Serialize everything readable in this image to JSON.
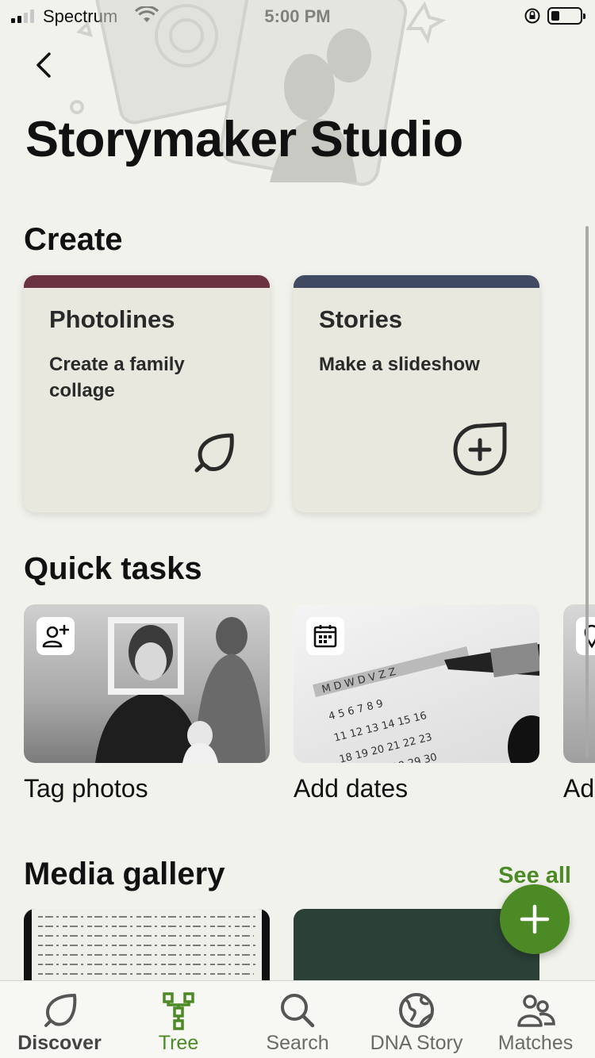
{
  "status_bar": {
    "carrier": "Spectrum",
    "time": "5:00 PM",
    "battery_level": 0.3
  },
  "header": {
    "title": "Storymaker Studio"
  },
  "create": {
    "heading": "Create",
    "cards": [
      {
        "title": "Photolines",
        "subtitle": "Create a family collage",
        "accent": "#6b3341",
        "icon": "leaf-icon"
      },
      {
        "title": "Stories",
        "subtitle": "Make a slideshow",
        "accent": "#414a63",
        "icon": "add-story-icon"
      }
    ]
  },
  "quick_tasks": {
    "heading": "Quick tasks",
    "items": [
      {
        "label": "Tag photos",
        "icon": "tag-person-icon"
      },
      {
        "label": "Add dates",
        "icon": "calendar-icon"
      },
      {
        "label": "Ad",
        "icon": "location-pin-icon"
      }
    ]
  },
  "media_gallery": {
    "heading": "Media gallery",
    "see_all": "See all"
  },
  "fab": {
    "icon": "plus-icon"
  },
  "tab_bar": {
    "tabs": [
      {
        "label": "Discover",
        "icon": "leaf-icon",
        "state": "current"
      },
      {
        "label": "Tree",
        "icon": "tree-icon",
        "state": "active"
      },
      {
        "label": "Search",
        "icon": "search-icon",
        "state": ""
      },
      {
        "label": "DNA Story",
        "icon": "globe-icon",
        "state": ""
      },
      {
        "label": "Matches",
        "icon": "people-icon",
        "state": ""
      }
    ]
  },
  "colors": {
    "brand_green": "#4b8a25",
    "background": "#f2f2ec",
    "card": "#e9e8de"
  }
}
